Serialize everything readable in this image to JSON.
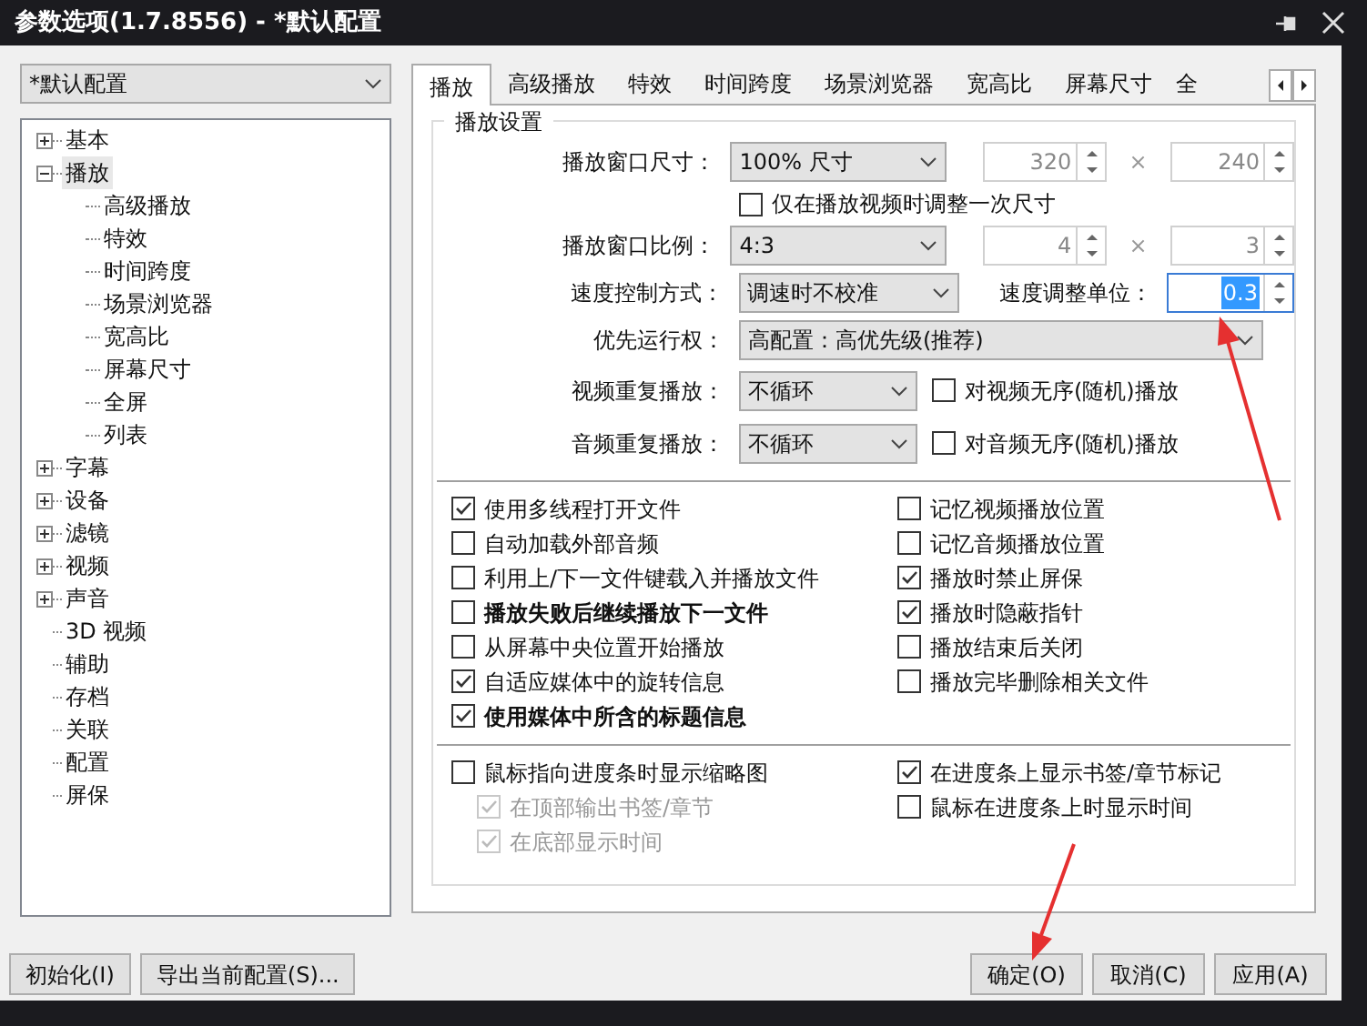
{
  "window": {
    "title": "参数选项(1.7.8556) - *默认配置"
  },
  "profile_select": {
    "value": "*默认配置"
  },
  "tree": [
    {
      "label": "基本",
      "expanded": false,
      "selected": false
    },
    {
      "label": "播放",
      "expanded": true,
      "selected": true,
      "children": [
        {
          "label": "高级播放"
        },
        {
          "label": "特效"
        },
        {
          "label": "时间跨度"
        },
        {
          "label": "场景浏览器"
        },
        {
          "label": "宽高比"
        },
        {
          "label": "屏幕尺寸"
        },
        {
          "label": "全屏"
        },
        {
          "label": "列表"
        }
      ]
    },
    {
      "label": "字幕",
      "expanded": false,
      "selected": false
    },
    {
      "label": "设备",
      "expanded": false,
      "selected": false
    },
    {
      "label": "滤镜",
      "expanded": false,
      "selected": false
    },
    {
      "label": "视频",
      "expanded": false,
      "selected": false
    },
    {
      "label": "声音",
      "expanded": false,
      "selected": false
    },
    {
      "label": "3D 视频",
      "kind": "leaf"
    },
    {
      "label": "辅助",
      "kind": "leaf"
    },
    {
      "label": "存档",
      "kind": "leaf"
    },
    {
      "label": "关联",
      "kind": "leaf"
    },
    {
      "label": "配置",
      "kind": "leaf"
    },
    {
      "label": "屏保",
      "kind": "leaf"
    }
  ],
  "tabs": [
    {
      "label": "播放",
      "selected": true
    },
    {
      "label": "高级播放",
      "selected": false
    },
    {
      "label": "特效",
      "selected": false
    },
    {
      "label": "时间跨度",
      "selected": false
    },
    {
      "label": "场景浏览器",
      "selected": false
    },
    {
      "label": "宽高比",
      "selected": false
    },
    {
      "label": "屏幕尺寸",
      "selected": false
    },
    {
      "label": "全",
      "selected": false
    }
  ],
  "group": {
    "title": "播放设置",
    "rows": [
      {
        "kind": "pair",
        "label": "播放窗口尺寸：",
        "select": "100% 尺寸",
        "spin1": "320",
        "times": "×",
        "spin2": "240"
      },
      {
        "kind": "check",
        "label": "仅在播放视频时调整一次尺寸",
        "checked": false
      },
      {
        "kind": "pair",
        "label": "播放窗口比例：",
        "select": "4:3",
        "spin1": "4",
        "times": "×",
        "spin2": "3"
      },
      {
        "kind": "speed",
        "label": "速度控制方式：",
        "select": "调速时不校准",
        "label2": "速度调整单位：",
        "spin": "0.3"
      },
      {
        "kind": "wide",
        "label": "优先运行权：",
        "select": "高配置：高优先级(推荐)"
      },
      {
        "kind": "repeat",
        "label": "视频重复播放：",
        "select": "不循环",
        "check_label": "对视频无序(随机)播放",
        "checked": false
      },
      {
        "kind": "repeat",
        "label": "音频重复播放：",
        "select": "不循环",
        "check_label": "对音频无序(随机)播放",
        "checked": false
      }
    ]
  },
  "options_left": [
    {
      "label": "使用多线程打开文件",
      "checked": true,
      "bold": false
    },
    {
      "label": "自动加载外部音频",
      "checked": false,
      "bold": false
    },
    {
      "label": "利用上/下一文件键载入并播放文件",
      "checked": false,
      "bold": false
    },
    {
      "label": "播放失败后继续播放下一文件",
      "checked": false,
      "bold": true
    },
    {
      "label": "从屏幕中央位置开始播放",
      "checked": false,
      "bold": false
    },
    {
      "label": "自适应媒体中的旋转信息",
      "checked": true,
      "bold": false
    },
    {
      "label": "使用媒体中所含的标题信息",
      "checked": true,
      "bold": true
    }
  ],
  "options_right": [
    {
      "label": "记忆视频播放位置",
      "checked": false
    },
    {
      "label": "记忆音频播放位置",
      "checked": false
    },
    {
      "label": "播放时禁止屏保",
      "checked": true
    },
    {
      "label": "播放时隐蔽指针",
      "checked": true
    },
    {
      "label": "播放结束后关闭",
      "checked": false
    },
    {
      "label": "播放完毕删除相关文件",
      "checked": false
    }
  ],
  "seek_left": [
    {
      "label": "鼠标指向进度条时显示缩略图",
      "checked": false,
      "disabled": false
    },
    {
      "label": "在顶部输出书签/章节",
      "checked": true,
      "disabled": true
    },
    {
      "label": "在底部显示时间",
      "checked": true,
      "disabled": true
    }
  ],
  "seek_right": [
    {
      "label": "在进度条上显示书签/章节标记",
      "checked": true
    },
    {
      "label": "鼠标在进度条上时显示时间",
      "checked": false
    }
  ],
  "buttons_left": [
    "初始化(I)",
    "导出当前配置(S)..."
  ],
  "buttons_right": [
    "确定(O)",
    "取消(C)",
    "应用(A)"
  ]
}
